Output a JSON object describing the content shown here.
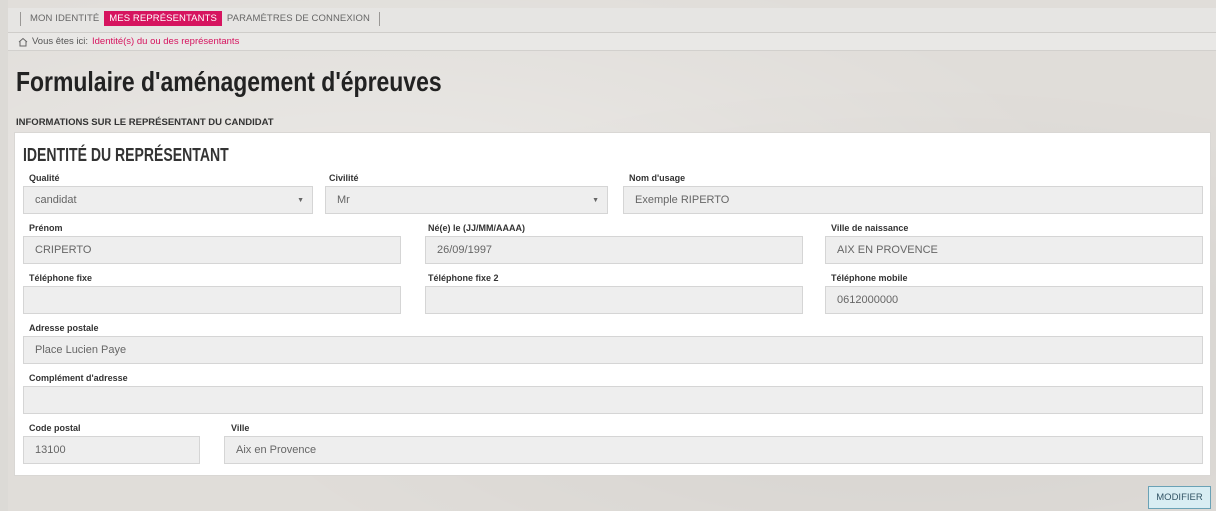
{
  "nav": {
    "tabs": [
      {
        "label": "MON IDENTITÉ"
      },
      {
        "label": "MES REPRÉSENTANTS"
      },
      {
        "label": "PARAMÈTRES DE CONNEXION"
      }
    ]
  },
  "breadcrumb": {
    "prefix": "Vous êtes ici:",
    "current": "Identité(s) du ou des représentants"
  },
  "page": {
    "title": "Formulaire d'aménagement d'épreuves",
    "section": "INFORMATIONS SUR LE REPRÉSENTANT DU CANDIDAT"
  },
  "panel": {
    "title": "IDENTITÉ DU REPRÉSENTANT",
    "fields": {
      "qualite": {
        "label": "Qualité",
        "value": "candidat"
      },
      "civilite": {
        "label": "Civilité",
        "value": "Mr"
      },
      "nom_usage": {
        "label": "Nom d'usage",
        "value": "Exemple RIPERTO"
      },
      "prenom": {
        "label": "Prénom",
        "value": "CRIPERTO"
      },
      "naissance": {
        "label": "Né(e) le (JJ/MM/AAAA)",
        "value": "26/09/1997"
      },
      "ville_naissance": {
        "label": "Ville de naissance",
        "value": "AIX EN PROVENCE"
      },
      "tel_fixe": {
        "label": "Téléphone fixe",
        "value": ""
      },
      "tel_fixe2": {
        "label": "Téléphone fixe 2",
        "value": ""
      },
      "tel_mobile": {
        "label": "Téléphone mobile",
        "value": "0612000000"
      },
      "adresse": {
        "label": "Adresse postale",
        "value": "Place Lucien Paye"
      },
      "complement": {
        "label": "Complément d'adresse",
        "value": ""
      },
      "code_postal": {
        "label": "Code postal",
        "value": "13100"
      },
      "ville": {
        "label": "Ville",
        "value": "Aix en Provence"
      }
    }
  },
  "actions": {
    "modify_label": "MODIFIER"
  },
  "colors": {
    "accent": "#d6145f",
    "field_bg": "#eeeeee",
    "button_bg": "#d8edf3"
  },
  "icons": {
    "home": "home-icon",
    "select_caret": "caret-down-icon"
  }
}
